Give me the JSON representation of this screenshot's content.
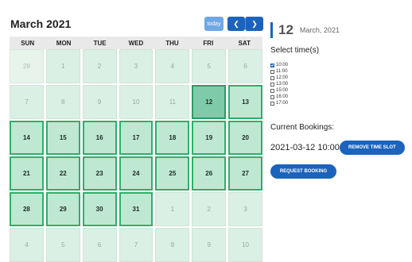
{
  "calendar": {
    "month_title": "March 2021",
    "today_label": "today",
    "prev_icon": "chevron-left-icon",
    "next_icon": "chevron-right-icon",
    "weekdays": [
      "SUN",
      "MON",
      "TUE",
      "WED",
      "THU",
      "FRI",
      "SAT"
    ],
    "days": [
      {
        "n": "28",
        "state": "faded"
      },
      {
        "n": "1",
        "state": "past"
      },
      {
        "n": "2",
        "state": "past"
      },
      {
        "n": "3",
        "state": "past"
      },
      {
        "n": "4",
        "state": "past"
      },
      {
        "n": "5",
        "state": "past"
      },
      {
        "n": "6",
        "state": "past"
      },
      {
        "n": "7",
        "state": "past"
      },
      {
        "n": "8",
        "state": "past"
      },
      {
        "n": "9",
        "state": "past"
      },
      {
        "n": "10",
        "state": "past"
      },
      {
        "n": "11",
        "state": "past"
      },
      {
        "n": "12",
        "state": "selected"
      },
      {
        "n": "13",
        "state": "active"
      },
      {
        "n": "14",
        "state": "active"
      },
      {
        "n": "15",
        "state": "active"
      },
      {
        "n": "16",
        "state": "active"
      },
      {
        "n": "17",
        "state": "active"
      },
      {
        "n": "18",
        "state": "active"
      },
      {
        "n": "19",
        "state": "active"
      },
      {
        "n": "20",
        "state": "active"
      },
      {
        "n": "21",
        "state": "active"
      },
      {
        "n": "22",
        "state": "active"
      },
      {
        "n": "23",
        "state": "active"
      },
      {
        "n": "24",
        "state": "active"
      },
      {
        "n": "25",
        "state": "active"
      },
      {
        "n": "26",
        "state": "active"
      },
      {
        "n": "27",
        "state": "active"
      },
      {
        "n": "28",
        "state": "active"
      },
      {
        "n": "29",
        "state": "active"
      },
      {
        "n": "30",
        "state": "active"
      },
      {
        "n": "31",
        "state": "active"
      },
      {
        "n": "1",
        "state": "past"
      },
      {
        "n": "2",
        "state": "past"
      },
      {
        "n": "3",
        "state": "past"
      },
      {
        "n": "4",
        "state": "past"
      },
      {
        "n": "5",
        "state": "past"
      },
      {
        "n": "6",
        "state": "past"
      },
      {
        "n": "7",
        "state": "past"
      },
      {
        "n": "8",
        "state": "past"
      },
      {
        "n": "9",
        "state": "past"
      },
      {
        "n": "10",
        "state": "past"
      }
    ]
  },
  "panel": {
    "day_number": "12",
    "month_year": "March, 2021",
    "select_label": "Select time(s)",
    "times": [
      {
        "label": "10:00",
        "checked": true
      },
      {
        "label": "11:00",
        "checked": false
      },
      {
        "label": "12:00",
        "checked": false
      },
      {
        "label": "13:00",
        "checked": false
      },
      {
        "label": "15:00",
        "checked": false
      },
      {
        "label": "16:00",
        "checked": false
      },
      {
        "label": "17:00",
        "checked": false
      }
    ],
    "bookings_label": "Current Bookings:",
    "booking_text": "2021-03-12 10:00",
    "remove_label": "REMOVE TIME SLOT",
    "request_label": "REQUEST BOOKING"
  },
  "colors": {
    "accent": "#1b63bd",
    "active_day": "#bfe8d2",
    "selected_day": "#7fcaa8",
    "past_day": "#daf0e4",
    "border_green": "#2eaf6a"
  }
}
